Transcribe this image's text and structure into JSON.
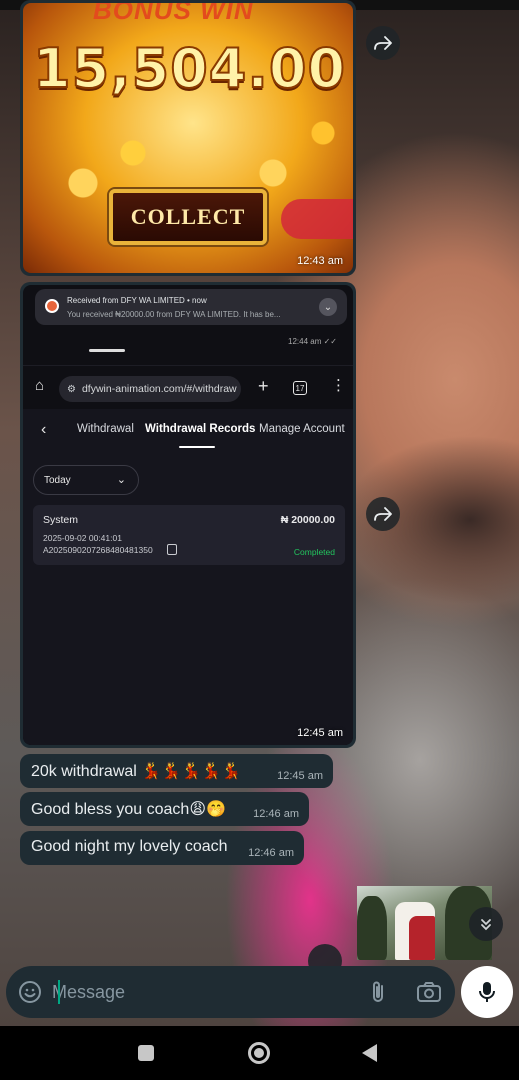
{
  "messages": {
    "jackpot_image": {
      "top_text": "BONUS WIN",
      "amount": "15,504.00",
      "collect_label": "COLLECT",
      "time": "12:43 am"
    },
    "screenshot_image": {
      "time": "12:45 am",
      "notification": {
        "title": "Received from DFY WA LIMITED  •  now",
        "body": "You received ₦20000.00 from DFY WA LIMITED. It has be..."
      },
      "mini_time": "12:44 am ✓✓",
      "browser": {
        "url": "dfywin-animation.com/#/withdraw",
        "tab_count": "17"
      },
      "app": {
        "tabs": [
          "Withdrawal",
          "Withdrawal Records",
          "Manage Account"
        ],
        "active_tab": "Withdrawal Records",
        "date_filter": "Today",
        "record": {
          "source": "System",
          "amount": "₦ 20000.00",
          "datetime": "2025-09-02 00:41:01",
          "txid": "A2025090207268480481350",
          "status": "Completed"
        }
      }
    },
    "texts": [
      {
        "text": "20k withdrawal 💃💃💃💃💃",
        "time": "12:45 am"
      },
      {
        "text": "Good bless you coach😩🤭",
        "time": "12:46 am"
      },
      {
        "text": "Good night my lovely coach",
        "time": "12:46 am"
      }
    ]
  },
  "composer": {
    "placeholder": "Message"
  },
  "colors": {
    "bubble": "#1f2c33",
    "accent": "#00a884",
    "status_completed": "#22c55e"
  },
  "icons": {
    "forward": "forward-icon",
    "emoji": "sticker-icon",
    "attach": "paperclip-icon",
    "camera": "camera-icon",
    "mic": "microphone-icon",
    "scroll": "double-chevron-down-icon"
  }
}
